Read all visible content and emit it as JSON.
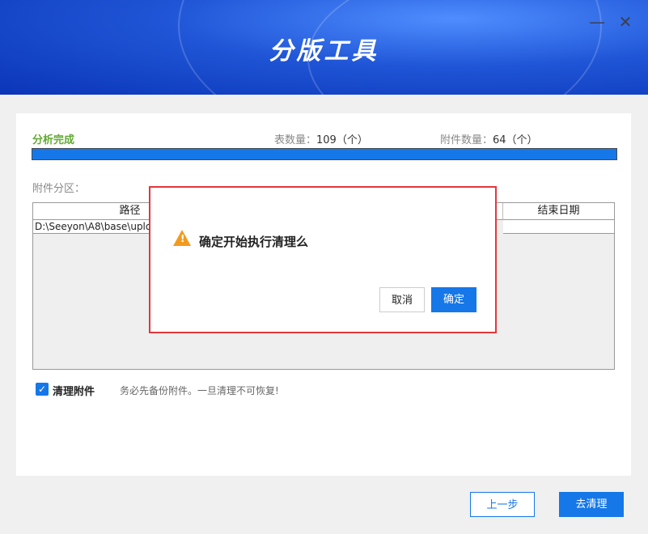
{
  "window": {
    "title": "分版工具",
    "minimize_label": "—",
    "close_label": "✕"
  },
  "status": {
    "label": "分析完成",
    "table_count_label": "表数量：",
    "table_count_value": "109（个）",
    "attachment_count_label": "附件数量：",
    "attachment_count_value": "64（个）",
    "progress_percent": 100
  },
  "partition": {
    "label": "附件分区：",
    "columns": [
      "路径",
      "结束日期"
    ],
    "rows": [
      {
        "path": "D:\\Seeyon\\A8\\base\\upload",
        "end_date": ""
      }
    ]
  },
  "options": {
    "clean_attachments_label": "清理附件",
    "clean_attachments_checked": true,
    "warning_hint": "务必先备份附件。一旦清理不可恢复!"
  },
  "footer": {
    "prev_label": "上一步",
    "clean_label": "去清理"
  },
  "dialog": {
    "message": "确定开始执行清理么",
    "icon": "warning-icon",
    "cancel_label": "取消",
    "ok_label": "确定"
  },
  "colors": {
    "accent": "#1677e8",
    "success": "#63a934",
    "warning": "#f39a1e",
    "dialog_border": "#e2373b"
  }
}
